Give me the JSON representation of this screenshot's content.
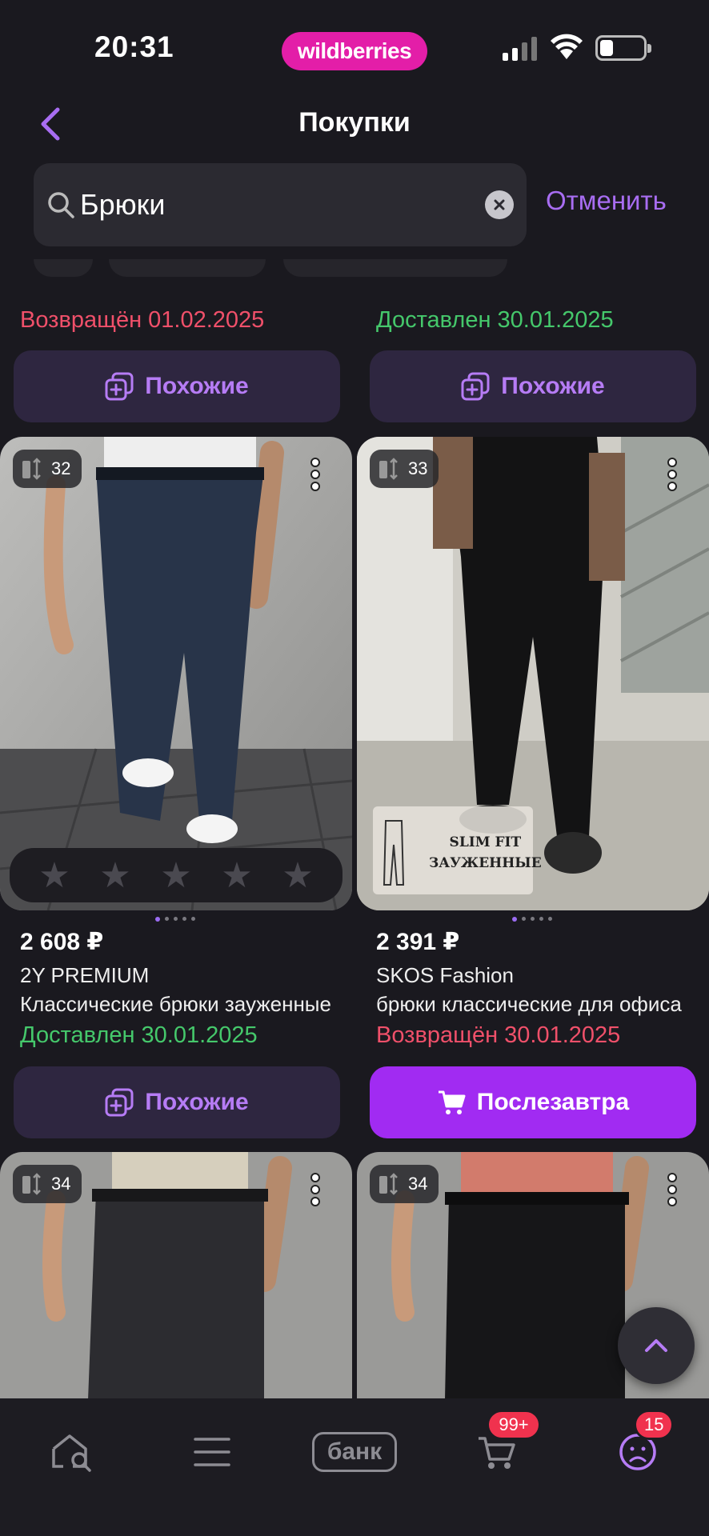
{
  "status_bar": {
    "time": "20:31",
    "brand": "wildberries"
  },
  "header": {
    "title": "Покупки"
  },
  "search": {
    "value": "Брюки",
    "cancel_label": "Отменить"
  },
  "top_row": [
    {
      "status": "Возвращён 01.02.2025",
      "status_color": "#f0506a",
      "button_label": "Похожие"
    },
    {
      "status": "Доставлен 30.01.2025",
      "status_color": "#45c86b",
      "button_label": "Похожие"
    }
  ],
  "products": [
    {
      "size": "32",
      "price": "2 608 ₽",
      "brand": "2Y PREMIUM",
      "name": "Классические брюки зауженные",
      "status": "Доставлен 30.01.2025",
      "status_color": "#45c86b",
      "button_label": "Похожие",
      "button_type": "similar",
      "rating_stars": 5
    },
    {
      "size": "33",
      "price": "2 391 ₽",
      "brand": "SKOS Fashion",
      "name": "брюки классические для офиса",
      "status": "Возвращён 30.01.2025",
      "status_color": "#f0506a",
      "button_label": "Послезавтра",
      "button_type": "cart",
      "photo_caption_1": "SLIM FIT",
      "photo_caption_2": "ЗАУЖЕННЫЕ"
    },
    {
      "size": "34"
    },
    {
      "size": "34"
    }
  ],
  "bottom_nav": {
    "bank_label": "банк",
    "cart_badge": "99+",
    "profile_badge": "15"
  },
  "colors": {
    "accent": "#a86df2",
    "primary_button": "#a12bf2",
    "brand_pink": "#e31ea8",
    "badge": "#f0324e"
  }
}
